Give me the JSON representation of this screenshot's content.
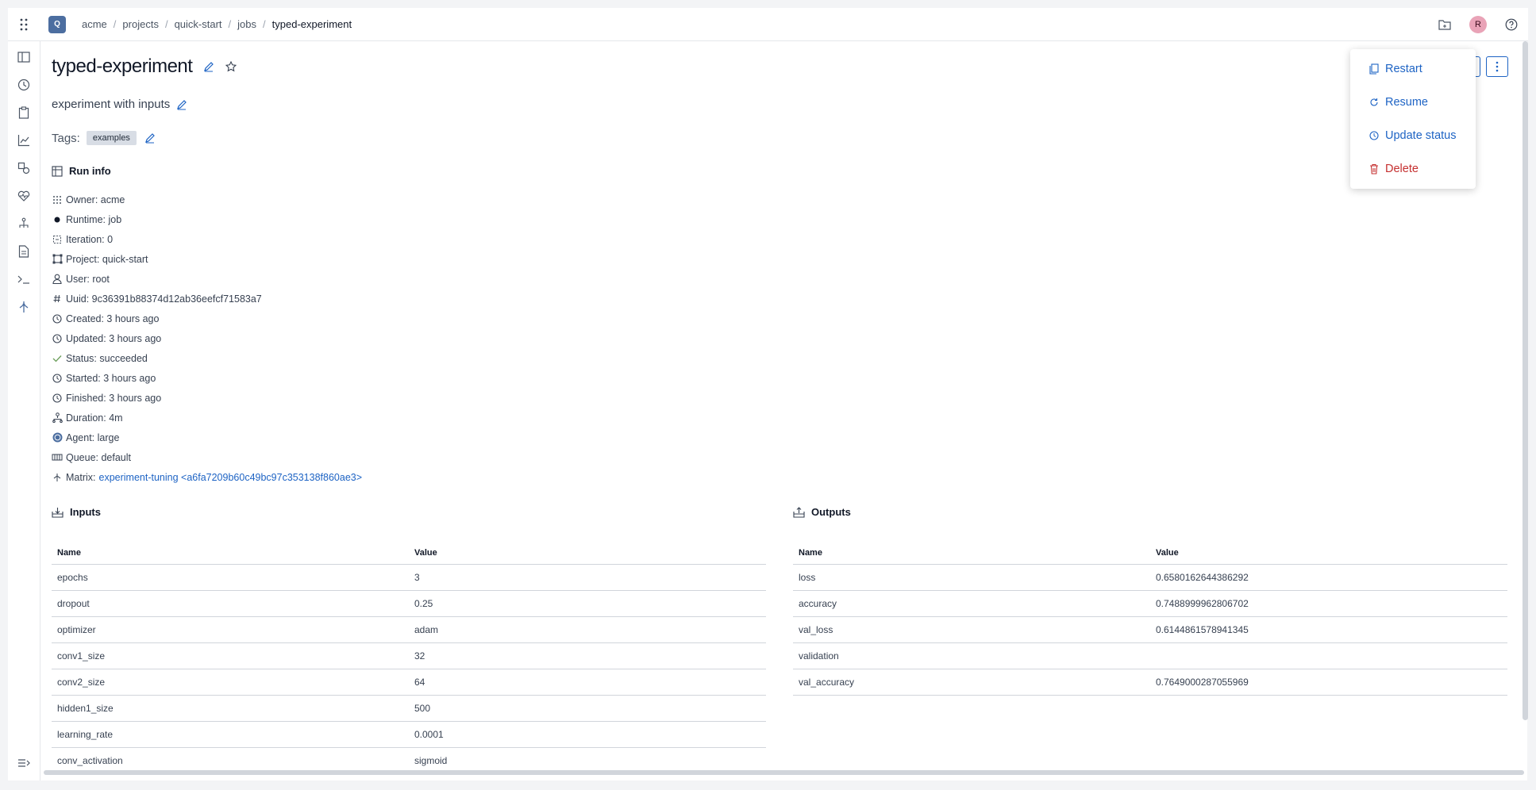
{
  "topbar": {
    "logo_letter": "Q",
    "breadcrumbs": [
      "acme",
      "projects",
      "quick-start",
      "jobs",
      "typed-experiment"
    ],
    "separator": "/",
    "avatar_letter": "R"
  },
  "run": {
    "title": "typed-experiment",
    "description": "experiment with inputs",
    "tags_label": "Tags:",
    "tags": [
      "examples"
    ]
  },
  "run_info": {
    "heading": "Run info",
    "items": [
      {
        "icon": "grid-icon",
        "text": "Owner: acme"
      },
      {
        "icon": "dot-icon",
        "text": "Runtime: job"
      },
      {
        "icon": "iteration-icon",
        "text": "Iteration: 0"
      },
      {
        "icon": "project-icon",
        "text": "Project: quick-start"
      },
      {
        "icon": "user-icon",
        "text": "User: root"
      },
      {
        "icon": "hash-icon",
        "text": "Uuid: 9c36391b88374d12ab36eefcf71583a7"
      },
      {
        "icon": "clock-icon",
        "text": "Created: 3 hours ago"
      },
      {
        "icon": "clock-icon",
        "text": "Updated: 3 hours ago"
      },
      {
        "icon": "check-icon",
        "text": "Status: succeeded"
      },
      {
        "icon": "clock-icon",
        "text": "Started: 3 hours ago"
      },
      {
        "icon": "clock-icon",
        "text": "Finished: 3 hours ago"
      },
      {
        "icon": "hierarchy-icon",
        "text": "Duration: 4m"
      },
      {
        "icon": "agent-icon",
        "text": "Agent: large"
      },
      {
        "icon": "queue-icon",
        "text": "Queue: default"
      }
    ],
    "matrix_label": "Matrix:",
    "matrix_link": "experiment-tuning <a6fa7209b60c49bc97c353138f860ae3>"
  },
  "inputs": {
    "heading": "Inputs",
    "columns": [
      "Name",
      "Value"
    ],
    "rows": [
      [
        "epochs",
        "3"
      ],
      [
        "dropout",
        "0.25"
      ],
      [
        "optimizer",
        "adam"
      ],
      [
        "conv1_size",
        "32"
      ],
      [
        "conv2_size",
        "64"
      ],
      [
        "hidden1_size",
        "500"
      ],
      [
        "learning_rate",
        "0.0001"
      ],
      [
        "conv_activation",
        "sigmoid"
      ]
    ]
  },
  "outputs": {
    "heading": "Outputs",
    "columns": [
      "Name",
      "Value"
    ],
    "rows": [
      [
        "loss",
        "0.6580162644386292"
      ],
      [
        "accuracy",
        "0.7488999962806702"
      ],
      [
        "val_loss",
        "0.6144861578941345"
      ],
      [
        "validation",
        ""
      ],
      [
        "val_accuracy",
        "0.7649000287055969"
      ]
    ]
  },
  "actions_menu": {
    "items": [
      {
        "label": "Restart",
        "icon": "copy-icon"
      },
      {
        "label": "Resume",
        "icon": "refresh-icon"
      },
      {
        "label": "Update status",
        "icon": "clock-icon"
      },
      {
        "label": "Delete",
        "icon": "trash-icon"
      }
    ]
  },
  "colors": {
    "accent": "#1d63c4",
    "danger": "#c53030",
    "logo": "#4c6ea0",
    "avatar": "#e9a3b7"
  }
}
